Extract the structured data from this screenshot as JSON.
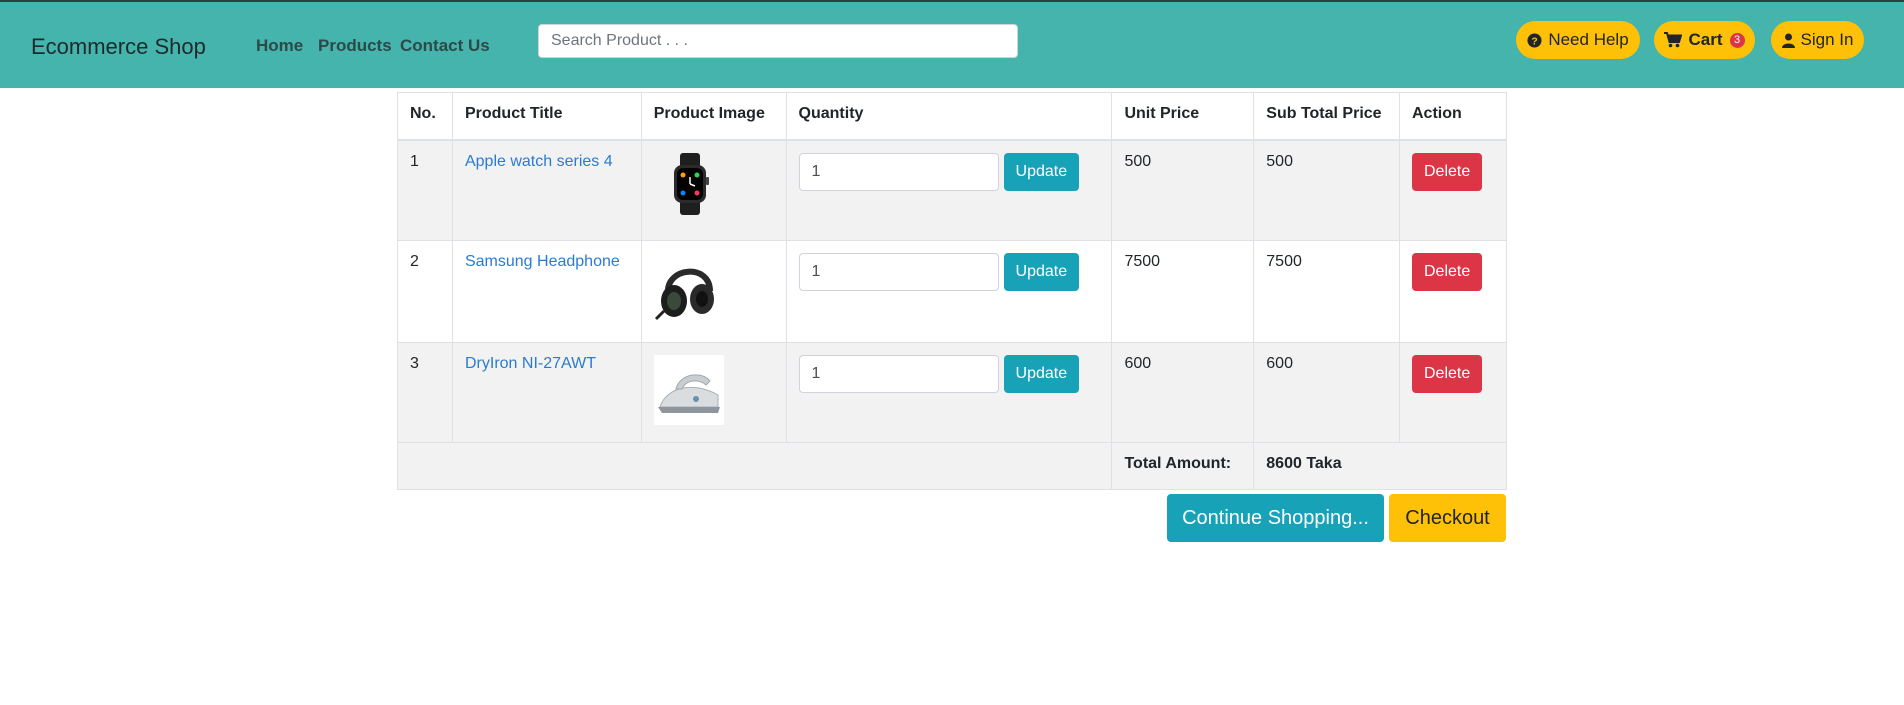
{
  "header": {
    "brand": "Ecommerce Shop",
    "nav": [
      "Home",
      "Products",
      "Contact Us"
    ],
    "search_placeholder": "Search Product . . .",
    "need_help": "Need Help",
    "cart": "Cart",
    "cart_count": "3",
    "sign_in": "Sign In",
    "icons": [
      "question-circle-icon",
      "cart-icon",
      "user-icon"
    ],
    "colors": {
      "navbar": "#45b4ad",
      "pill": "#ffc107",
      "badge": "#dc3545"
    }
  },
  "table": {
    "columns": [
      "No.",
      "Product Title",
      "Product Image",
      "Quantity",
      "Unit Price",
      "Sub Total Price",
      "Action"
    ],
    "rows": [
      {
        "no": "1",
        "title": "Apple watch series 4",
        "image": "smartwatch-image",
        "qty": "1",
        "unit_price": "500",
        "subtotal": "500"
      },
      {
        "no": "2",
        "title": "Samsung Headphone",
        "image": "headphone-image",
        "qty": "1",
        "unit_price": "7500",
        "subtotal": "7500"
      },
      {
        "no": "3",
        "title": "DryIron NI-27AWT",
        "image": "iron-image",
        "qty": "1",
        "unit_price": "600",
        "subtotal": "600"
      }
    ],
    "update_label": "Update",
    "delete_label": "Delete",
    "total_label": "Total Amount:",
    "total_value": "8600 Taka"
  },
  "actions": {
    "continue": "Continue Shopping...",
    "checkout": "Checkout",
    "colors": {
      "continue": "#17a2b8",
      "checkout": "#ffc107",
      "update": "#17a2b8",
      "delete": "#dc3545"
    }
  }
}
